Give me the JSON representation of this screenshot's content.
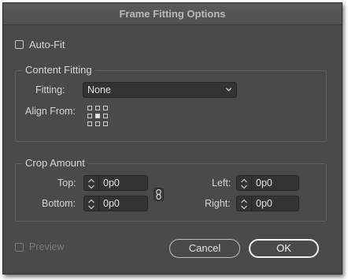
{
  "dialog": {
    "title": "Frame Fitting Options"
  },
  "auto_fit": {
    "label": "Auto-Fit",
    "checked": false
  },
  "content_fitting": {
    "title": "Content Fitting",
    "fitting_label": "Fitting:",
    "fitting_value": "None",
    "align_from_label": "Align From:",
    "align_from_selected": "center"
  },
  "crop_amount": {
    "title": "Crop Amount",
    "top": {
      "label": "Top:",
      "value": "0p0"
    },
    "bottom": {
      "label": "Bottom:",
      "value": "0p0"
    },
    "left": {
      "label": "Left:",
      "value": "0p0"
    },
    "right": {
      "label": "Right:",
      "value": "0p0"
    },
    "link_icon": "chain-link-icon"
  },
  "preview": {
    "label": "Preview",
    "checked": false,
    "enabled": false
  },
  "buttons": {
    "cancel": "Cancel",
    "ok": "OK"
  },
  "colors": {
    "background": "#4a4a4a",
    "field": "#333333",
    "title_bar": "#505050"
  }
}
